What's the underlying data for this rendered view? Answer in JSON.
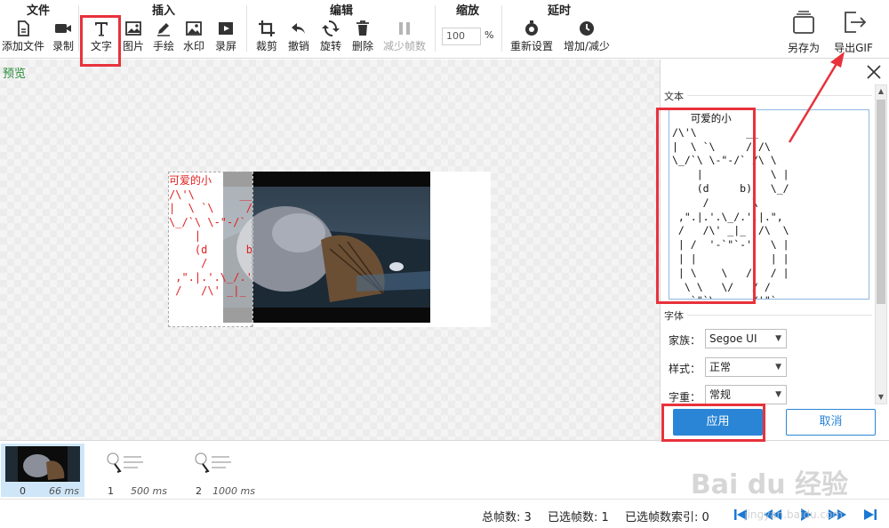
{
  "ribbon": {
    "groups": {
      "file": "文件",
      "insert": "插入",
      "edit": "编辑",
      "zoom": "缩放",
      "delay": "延时"
    },
    "buttons": {
      "add_file": "添加文件",
      "record": "录制",
      "text": "文字",
      "image": "图片",
      "draw": "手绘",
      "watermark": "水印",
      "screen_record": "录屏",
      "crop": "裁剪",
      "undo": "撤销",
      "rotate": "旋转",
      "delete": "删除",
      "reduce_frames": "减少帧数",
      "reset": "重新设置",
      "add_reduce": "增加/减少",
      "save_as": "另存为",
      "export_gif": "导出GIF"
    },
    "zoom_value": "100",
    "zoom_unit": "%"
  },
  "preview": {
    "label": "预览",
    "overlay_text": "可爱的小\n/\\'\\       __\n|  \\ `\\     /`/\\\n\\_/`\\ \\-\"-/` /\\ \\\n    |         |  \\ |\n    (d      b)  \\_/\n     /        \\\n ,\".|.'.\\_/.'.|.\",\n /   /\\' _|_ '/\\  \\\n"
  },
  "panel": {
    "text_section": "文本",
    "text_content": "   可爱的小\n/\\'\\        __\n|  \\ `\\     /`/\\\n\\_/`\\ \\-\"-/` /\\ \\\n    |        |  \\ |\n    (d     b)   \\_/\n     /       \\\n ,\".|.'.\\_/.'.|.\",\n /   /\\' _|_ '/\\  \\\n | /  '-`\"`-'   \\ |\n | |            | |\n | \\    \\   /   / |\n  \\ \\   \\/   / /\n   `\"`\\   :  /'\"`\n       `\"\"`\"\"`",
    "font_section": "字体",
    "family_label": "家族：",
    "family_value": "Segoe UI",
    "style_label": "样式：",
    "style_value": "正常",
    "weight_label": "字重：",
    "weight_value": "常规",
    "apply": "应用",
    "cancel": "取消"
  },
  "timeline": {
    "frames": [
      {
        "index": "0",
        "duration": "66 ms"
      },
      {
        "index": "1",
        "duration": "500 ms"
      },
      {
        "index": "2",
        "duration": "1000 ms"
      }
    ]
  },
  "status": {
    "total_frames": "总帧数: 3",
    "selected_frames": "已选帧数: 1",
    "selected_index": "已选帧数索引: 0"
  },
  "watermark": {
    "brand": "Bai du 经验",
    "url": "jingyan.baidu.com"
  },
  "colors": {
    "accent": "#2a85d6",
    "highlight": "#e8323c",
    "preview_label": "#2a8a3a",
    "overlay_text": "#e02020"
  }
}
